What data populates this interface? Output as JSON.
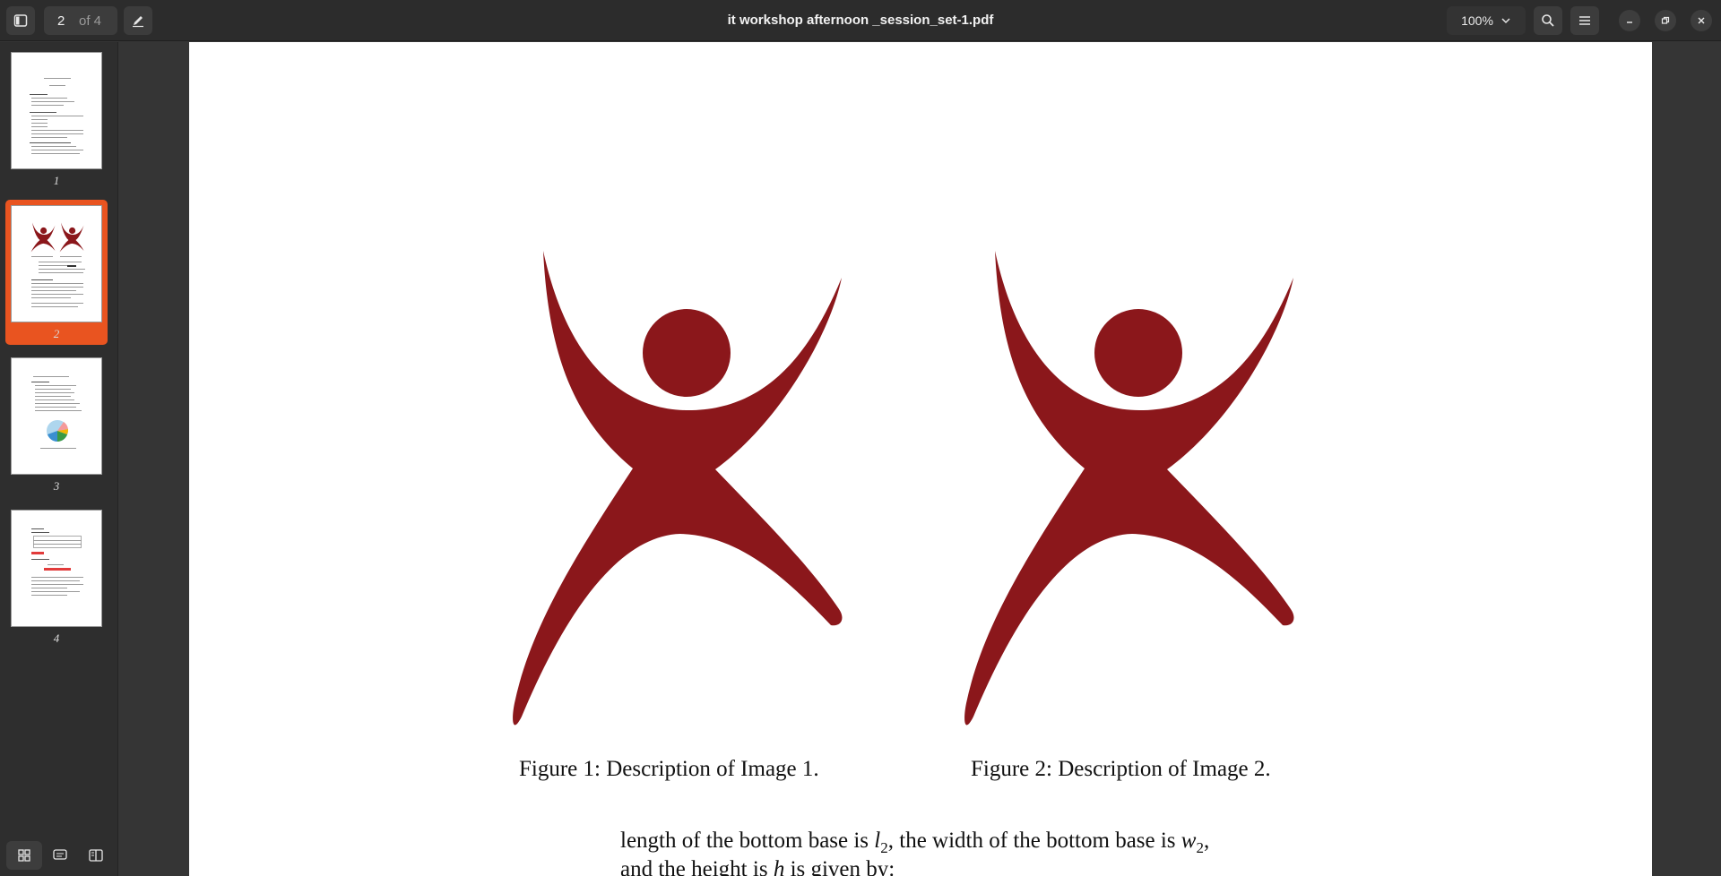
{
  "header": {
    "title": "it workshop afternoon _session_set-1.pdf",
    "current_page": "2",
    "page_count_label": "of 4",
    "zoom": "100%",
    "icons": {
      "sidebar_toggle": "sidebar-toggle-icon",
      "annotate": "pen-icon",
      "search": "search-icon",
      "menu": "hamburger-menu-icon",
      "minimize": "minimize-icon",
      "restore": "restore-icon",
      "close": "close-icon"
    }
  },
  "sidebar": {
    "thumbnails": [
      {
        "label": "1"
      },
      {
        "label": "2"
      },
      {
        "label": "3"
      },
      {
        "label": "4"
      }
    ],
    "active_index": 1,
    "accent": "#e95420"
  },
  "document": {
    "figure_color": "#8b171b",
    "captions": {
      "fig1": "Figure 1: Description of Image 1.",
      "fig2": "Figure 2: Description of Image 2."
    },
    "body": {
      "line1_a": "length of the bottom base is ",
      "line1_var1": "l",
      "line1_sub1": "2",
      "line1_b": ", the width of the bottom base is ",
      "line1_var2": "w",
      "line1_sub2": "2",
      "line1_c": ",",
      "line2_a": "and the height is ",
      "line2_var": "h",
      "line2_b": " is given by:"
    }
  }
}
